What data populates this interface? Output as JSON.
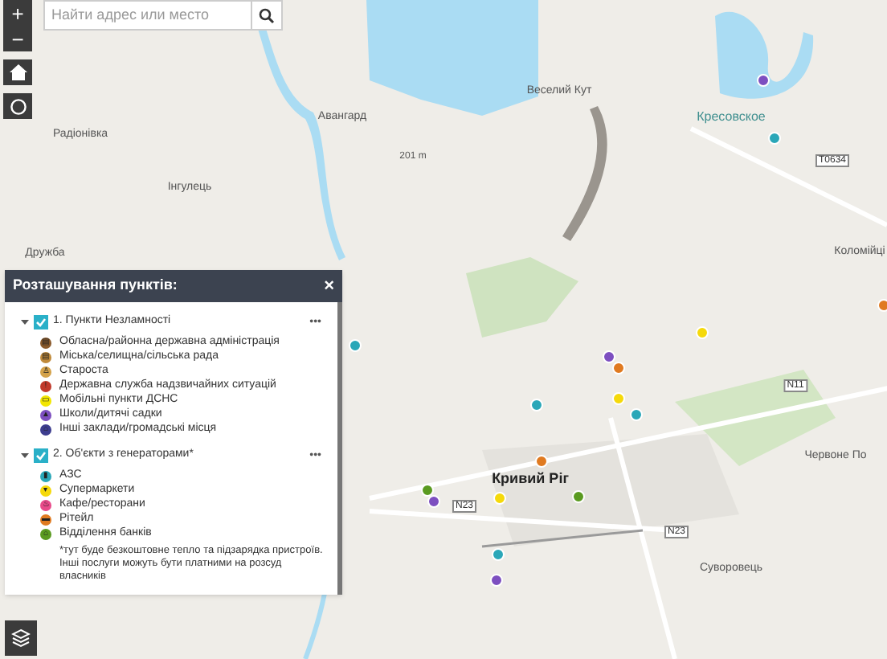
{
  "search": {
    "placeholder": "Найти адрес или место"
  },
  "map_controls": [
    {
      "kind": "zoom-in",
      "label": "+"
    },
    {
      "kind": "zoom-out",
      "label": "−"
    },
    {
      "kind": "home"
    },
    {
      "kind": "locate"
    }
  ],
  "map_labels": [
    {
      "text": "Радіонівка",
      "kind": "place"
    },
    {
      "text": "Інгулець",
      "kind": "place"
    },
    {
      "text": "Авангард",
      "kind": "place"
    },
    {
      "text": "Веселий Кут",
      "kind": "place"
    },
    {
      "text": "201 m",
      "kind": "elevation"
    },
    {
      "text": "Кресовское",
      "kind": "district"
    },
    {
      "text": "T0634",
      "kind": "road"
    },
    {
      "text": "Коломійці",
      "kind": "place"
    },
    {
      "text": "Дружба",
      "kind": "place"
    },
    {
      "text": "Кривий Ріг",
      "kind": "city"
    },
    {
      "text": "N23",
      "kind": "road"
    },
    {
      "text": "N11",
      "kind": "road"
    },
    {
      "text": "N23",
      "kind": "road"
    },
    {
      "text": "Червоне По",
      "kind": "place"
    },
    {
      "text": "Суворовець",
      "kind": "place"
    }
  ],
  "legend": {
    "title": "Розташування пунктів:",
    "close": "×",
    "groups": [
      {
        "label": "1. Пункти Незламності",
        "expanded": true,
        "checked": true,
        "menu": "•••",
        "items": [
          {
            "label": "Обласна/районна державна адміністрація",
            "color": "#8a5a2b",
            "glyph": "▤"
          },
          {
            "label": "Міська/селищна/сільська рада",
            "color": "#c08a3a",
            "glyph": "▤"
          },
          {
            "label": "Староста",
            "color": "#d4a24a",
            "glyph": "♙"
          },
          {
            "label": "Державна служба надзвичайних ситуацій",
            "color": "#c0392b",
            "glyph": "!"
          },
          {
            "label": "Мобільні пункти ДСНС",
            "color": "#f2e600",
            "glyph": "▭"
          },
          {
            "label": "Школи/дитячі садки",
            "color": "#7d4fc0",
            "glyph": "▲"
          },
          {
            "label": "Інші заклади/громадські місця",
            "color": "#3d3d8f",
            "glyph": "⌂"
          }
        ]
      },
      {
        "label": "2. Об'єкти з генераторами*",
        "expanded": true,
        "checked": true,
        "menu": "•••",
        "items": [
          {
            "label": "АЗС",
            "color": "#2aa7b8",
            "glyph": "▮"
          },
          {
            "label": "Супермаркети",
            "color": "#f5d90a",
            "glyph": "▾"
          },
          {
            "label": "Кафе/ресторани",
            "color": "#e84a8a",
            "glyph": "♨"
          },
          {
            "label": "Рітейл",
            "color": "#e07a20",
            "glyph": "▬"
          },
          {
            "label": "Відділення банків",
            "color": "#5a9a20",
            "glyph": "⌂"
          }
        ],
        "note": "*тут буде безкоштовне тепло та підзарядка пристроїв. Інші послуги можуть бути платними на розсуд власників"
      }
    ]
  },
  "markers": [
    {
      "color": "#7d4fc0"
    },
    {
      "color": "#2aa7b8"
    },
    {
      "color": "#2aa7b8"
    },
    {
      "color": "#7d4fc0"
    },
    {
      "color": "#e07a20"
    },
    {
      "color": "#f5d90a"
    },
    {
      "color": "#f5d90a"
    },
    {
      "color": "#2aa7b8"
    },
    {
      "color": "#2aa7b8"
    },
    {
      "color": "#e07a20"
    },
    {
      "color": "#e07a20"
    },
    {
      "color": "#5a9a20"
    },
    {
      "color": "#f5d90a"
    },
    {
      "color": "#5a9a20"
    },
    {
      "color": "#7d4fc0"
    },
    {
      "color": "#2aa7b8"
    },
    {
      "color": "#7d4fc0"
    }
  ]
}
